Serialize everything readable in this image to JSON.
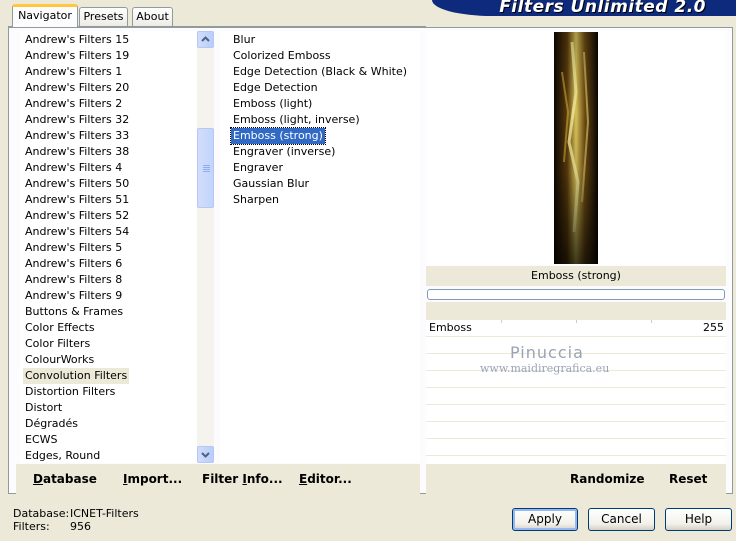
{
  "tabs": [
    "Navigator",
    "Presets",
    "About"
  ],
  "banner_title": "Filters Unlimited 2.0",
  "categories": [
    "Andrew's Filters 15",
    "Andrew's Filters 19",
    "Andrew's Filters 1",
    "Andrew's Filters 20",
    "Andrew's Filters 2",
    "Andrew's Filters 32",
    "Andrew's Filters 33",
    "Andrew's Filters 38",
    "Andrew's Filters 4",
    "Andrew's Filters 50",
    "Andrew's Filters 51",
    "Andrew's Filters 52",
    "Andrew's Filters 54",
    "Andrew's Filters 5",
    "Andrew's Filters 6",
    "Andrew's Filters 8",
    "Andrew's Filters 9",
    "Buttons & Frames",
    "Color Effects",
    "Color Filters",
    "ColourWorks",
    "Convolution Filters",
    "Distortion Filters",
    "Distort",
    "Dégradés",
    "ECWS",
    "Edges, Round"
  ],
  "selected_category": "Convolution Filters",
  "filters": [
    "Blur",
    "Colorized Emboss",
    "Edge Detection (Black & White)",
    "Edge Detection",
    "Emboss (light)",
    "Emboss (light, inverse)",
    "Emboss (strong)",
    "Engraver (inverse)",
    "Engraver",
    "Gaussian Blur",
    "Sharpen"
  ],
  "selected_filter": "Emboss (strong)",
  "preview": {
    "filter_name": "Emboss (strong)"
  },
  "parameter": {
    "name": "Emboss",
    "value": "255"
  },
  "left_toolbar": {
    "database_pre": "",
    "database_u": "D",
    "database_post": "atabase",
    "import_pre": "",
    "import_u": "I",
    "import_post": "mport...",
    "filterinfo_pre": "Filter ",
    "filterinfo_u": "I",
    "filterinfo_post": "nfo...",
    "editor_pre": "",
    "editor_u": "E",
    "editor_post": "ditor..."
  },
  "right_toolbar": {
    "randomize": "Randomize",
    "reset": "Reset"
  },
  "status": {
    "database_label": "Database:",
    "database_value": "ICNET-Filters",
    "filters_label": "Filters:",
    "filters_value": "956"
  },
  "buttons": {
    "apply": "Apply",
    "cancel": "Cancel",
    "help": "Help"
  },
  "watermark": {
    "name": "Pinuccia",
    "site": "www.maidiregrafica.eu"
  },
  "colors": {
    "selection": "#316ac5",
    "banner": "#0d2a7c",
    "tab_highlight": "#ffc73c"
  }
}
